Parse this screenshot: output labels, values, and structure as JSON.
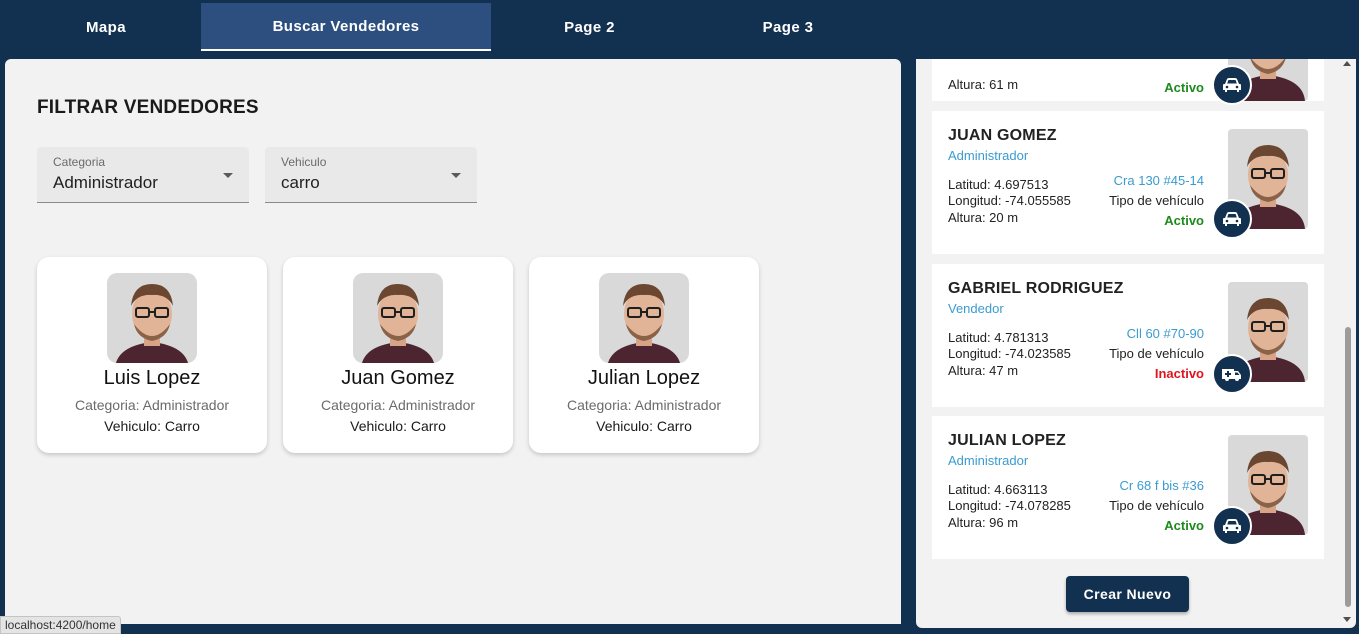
{
  "nav": {
    "tabs": [
      {
        "label": "Mapa"
      },
      {
        "label": "Buscar Vendedores"
      },
      {
        "label": "Page 2"
      },
      {
        "label": "Page 3"
      }
    ]
  },
  "filter": {
    "title": "FILTRAR VENDEDORES",
    "category": {
      "label": "Categoria",
      "value": "Administrador"
    },
    "vehicle": {
      "label": "Vehiculo",
      "value": "carro"
    }
  },
  "results": [
    {
      "name": "Luis Lopez",
      "category": "Categoria: Administrador",
      "vehicle": "Vehiculo: Carro"
    },
    {
      "name": "Juan Gomez",
      "category": "Categoria: Administrador",
      "vehicle": "Vehiculo: Carro"
    },
    {
      "name": "Julian Lopez",
      "category": "Categoria: Administrador",
      "vehicle": "Vehiculo: Carro"
    }
  ],
  "sellers": [
    {
      "altura": "Altura: 61 m",
      "status": "Activo"
    },
    {
      "name": "JUAN GOMEZ",
      "role": "Administrador",
      "lat": "Latitud: 4.697513",
      "lon": "Longitud: -74.055585",
      "altura": "Altura: 20 m",
      "address": "Cra 130 #45-14",
      "vehicle_type": "Tipo de vehículo",
      "status": "Activo"
    },
    {
      "name": "GABRIEL RODRIGUEZ",
      "role": "Vendedor",
      "lat": "Latitud: 4.781313",
      "lon": "Longitud: -74.023585",
      "altura": "Altura: 47 m",
      "address": "Cll 60 #70-90",
      "vehicle_type": "Tipo de vehículo",
      "status": "Inactivo"
    },
    {
      "name": "JULIAN LOPEZ",
      "role": "Administrador",
      "lat": "Latitud: 4.663113",
      "lon": "Longitud: -74.078285",
      "altura": "Altura: 96 m",
      "address": "Cr 68 f bis #36",
      "vehicle_type": "Tipo de vehículo",
      "status": "Activo"
    }
  ],
  "create_button": "Crear Nuevo",
  "status_url": "localhost:4200/home",
  "colors": {
    "navy": "#12304f",
    "active_tab": "#2d4f7f",
    "accent_blue": "#3a9bd0",
    "active_green": "#1e8a1e",
    "inactive_red": "#e0141e"
  },
  "icons": {
    "car": "car-icon",
    "ambulance": "ambulance-icon",
    "dropdown": "chevron-down-icon"
  }
}
